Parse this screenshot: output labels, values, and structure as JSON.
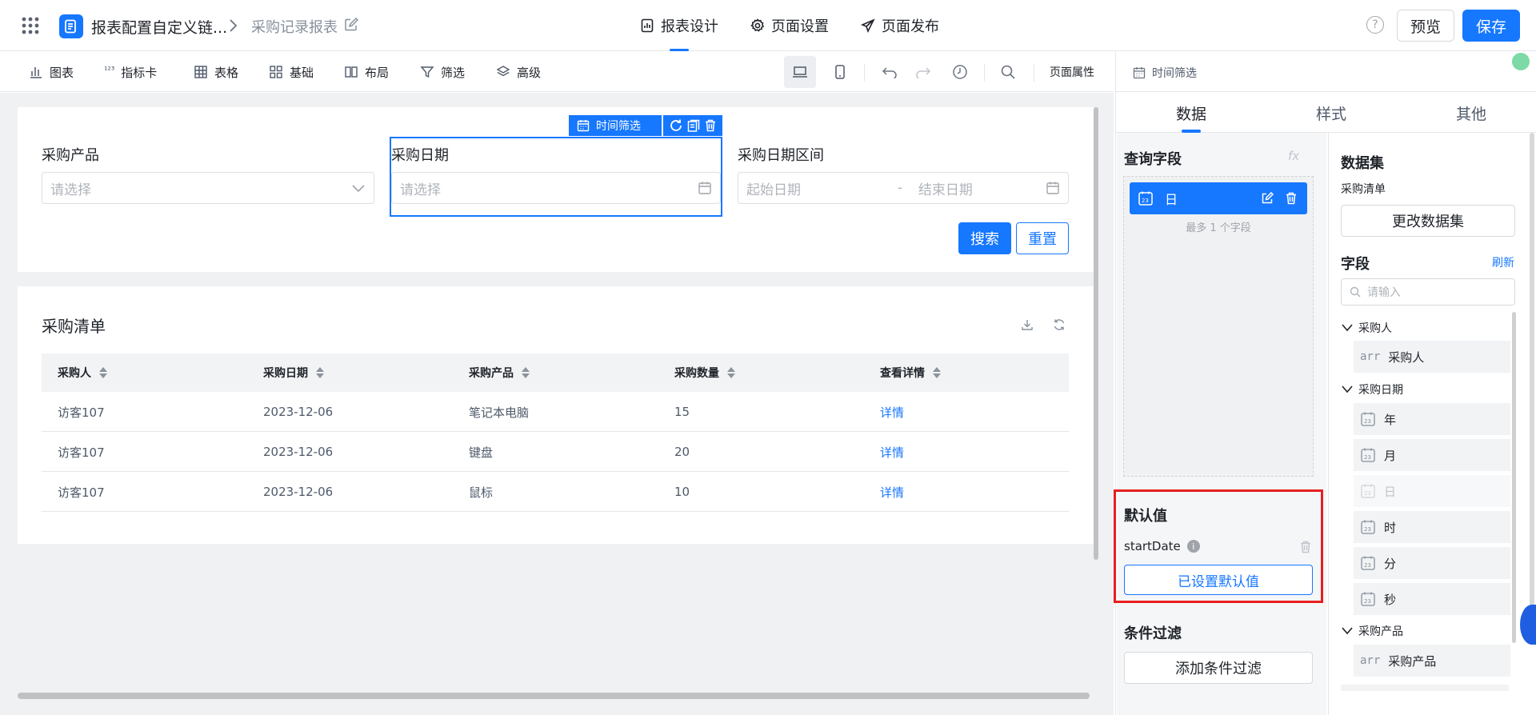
{
  "header": {
    "app_title": "报表配置自定义链...",
    "page_name": "采购记录报表",
    "tabs": [
      "报表设计",
      "页面设置",
      "页面发布"
    ],
    "preview_label": "预览",
    "save_label": "保存",
    "help_label": "?"
  },
  "toolbar": {
    "items": [
      "图表",
      "指标卡",
      "表格",
      "基础",
      "布局",
      "筛选",
      "高级"
    ],
    "page_props_label": "页面属性"
  },
  "filter": {
    "product_label": "采购产品",
    "product_placeholder": "请选择",
    "date_label": "采购日期",
    "date_placeholder": "请选择",
    "range_label": "采购日期区间",
    "range_start": "起始日期",
    "range_sep": "-",
    "range_end": "结束日期",
    "selected_tag": "时间筛选",
    "search_label": "搜索",
    "reset_label": "重置"
  },
  "table": {
    "title": "采购清单",
    "columns": [
      "采购人",
      "采购日期",
      "采购产品",
      "采购数量",
      "查看详情"
    ],
    "rows": [
      [
        "访客107",
        "2023-12-06",
        "笔记本电脑",
        "15",
        "详情"
      ],
      [
        "访客107",
        "2023-12-06",
        "键盘",
        "20",
        "详情"
      ],
      [
        "访客107",
        "2023-12-06",
        "鼠标",
        "10",
        "详情"
      ]
    ]
  },
  "panel": {
    "component_name": "时间筛选",
    "tabs": [
      "数据",
      "样式",
      "其他"
    ],
    "query_field_title": "查询字段",
    "fx_label": "fx",
    "query_field": "日",
    "query_hint": "最多 1 个字段",
    "default_title": "默认值",
    "default_param": "startDate",
    "default_button": "已设置默认值",
    "condition_title": "条件过滤",
    "condition_button": "添加条件过滤",
    "dataset_title": "数据集",
    "dataset_name": "采购清单",
    "change_dataset": "更改数据集",
    "fields_title": "字段",
    "refresh_label": "刷新",
    "field_search_placeholder": "请输入",
    "groups": [
      {
        "name": "采购人",
        "items": [
          {
            "tag": "arr",
            "label": "采购人"
          }
        ]
      },
      {
        "name": "采购日期",
        "items": [
          {
            "tag": "cal",
            "label": "年"
          },
          {
            "tag": "cal",
            "label": "月"
          },
          {
            "tag": "cal",
            "label": "日",
            "disabled": true
          },
          {
            "tag": "cal",
            "label": "时"
          },
          {
            "tag": "cal",
            "label": "分"
          },
          {
            "tag": "cal",
            "label": "秒"
          }
        ]
      },
      {
        "name": "采购产品",
        "items": [
          {
            "tag": "arr",
            "label": "采购产品"
          }
        ]
      }
    ]
  },
  "colors": {
    "primary": "#1677ff",
    "highlight": "#e62020",
    "canvas_bg": "#f0f1f3"
  }
}
